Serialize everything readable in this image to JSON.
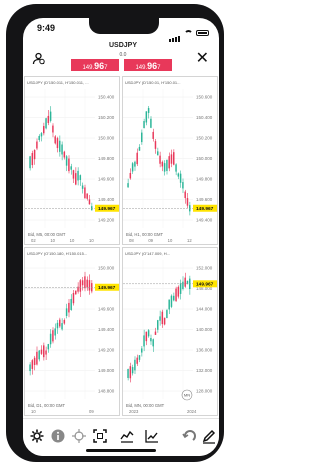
{
  "status_bar": {
    "time": "9:49"
  },
  "header": {
    "symbol": "USDJPY",
    "spread": "0.0",
    "bid": {
      "prefix": "149.",
      "big": "96",
      "suffix": "7"
    },
    "ask": {
      "prefix": "149.",
      "big": "96",
      "suffix": "7"
    }
  },
  "charts": [
    {
      "header": "USDJPY (D'150.011, H'150.011, ...",
      "price_labels": [
        "150.400",
        "150.200",
        "150.000",
        "149.800",
        "149.600",
        "149.400",
        "149.200"
      ],
      "current_price": "149.967",
      "current_price_color": "#ffe400",
      "footer_left": "Bid, M5, 00:00 GMT",
      "time_labels": [
        "02",
        "10",
        "10",
        "10"
      ],
      "candle_colors": {
        "up": "#2bb598",
        "down": "#e8385a"
      }
    },
    {
      "header": "USDJPY (D'150.01, H'150.01...",
      "price_labels": [
        "150.600",
        "150.400",
        "150.200",
        "150.000",
        "149.800",
        "149.600",
        "149.400"
      ],
      "current_price": "149.967",
      "current_price_color": "#ffe400",
      "footer_left": "Bid, H1, 00:00 GMT",
      "time_labels": [
        "08",
        "09",
        "10",
        "12"
      ],
      "candle_colors": {
        "up": "#2bb598",
        "down": "#e8385a"
      }
    },
    {
      "header": "USDJPY (O'150.180, H'150.015...",
      "price_labels": [
        "150.000",
        "149.800",
        "149.600",
        "149.400",
        "149.200",
        "149.000",
        "148.800"
      ],
      "current_price": "149.967",
      "current_price_color": "#ffe400",
      "footer_left": "Bid, D1, 00:00 GMT",
      "time_labels": [
        "10",
        "09"
      ],
      "candle_colors": {
        "up": "#2bb598",
        "down": "#e8385a"
      }
    },
    {
      "header": "USDJPY (O'147.009, H...",
      "price_labels": [
        "152.000",
        "148.000",
        "144.000",
        "140.000",
        "136.000",
        "132.000",
        "128.000"
      ],
      "current_price": "149.967",
      "current_price_color": "#ffe400",
      "footer_left": "Bid, MN, 00:00 GMT",
      "time_labels": [
        "2023",
        "2024"
      ],
      "candle_colors": {
        "up": "#2bb598",
        "down": "#e8385a"
      },
      "badge": "MN"
    }
  ],
  "toolbar": {
    "icons": [
      "gear-icon",
      "info-icon",
      "crosshair-icon",
      "fullscreen-icon",
      "indicators-icon",
      "chart-type-icon",
      "period-icon",
      "undo-icon",
      "draw-icon"
    ],
    "accent": "#111111"
  }
}
